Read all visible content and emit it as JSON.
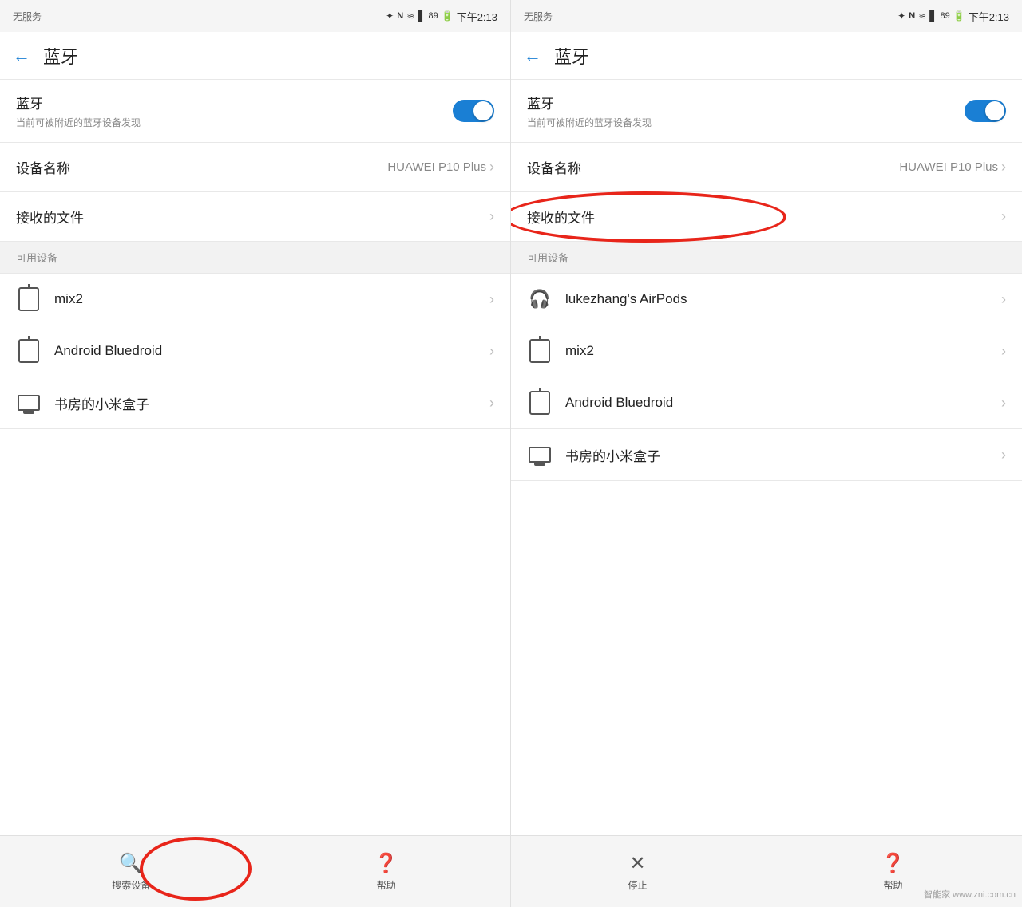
{
  "left_panel": {
    "status": {
      "left_text": "无服务",
      "right_icons": "✦ NFC ≋ □",
      "battery_pct": "89",
      "time": "下午2:13"
    },
    "header": {
      "back_label": "←",
      "title": "蓝牙"
    },
    "bluetooth": {
      "label": "蓝牙",
      "sublabel": "当前可被附近的蓝牙设备发现",
      "toggle_on": true
    },
    "device_name": {
      "label": "设备名称",
      "value": "HUAWEI P10 Plus"
    },
    "received_files": {
      "label": "接收的文件"
    },
    "available_section": "可用设备",
    "devices": [
      {
        "icon": "tablet",
        "name": "mix2"
      },
      {
        "icon": "tablet",
        "name": "Android Bluedroid"
      },
      {
        "icon": "tv",
        "name": "书房的小米盒子"
      }
    ],
    "bottom_bar": {
      "search_label": "搜索设备",
      "help_label": "帮助"
    }
  },
  "right_panel": {
    "status": {
      "left_text": "无服务",
      "right_icons": "✦ NFC ≋ □",
      "battery_pct": "89",
      "time": "下午2:13"
    },
    "header": {
      "back_label": "←",
      "title": "蓝牙"
    },
    "bluetooth": {
      "label": "蓝牙",
      "sublabel": "当前可被附近的蓝牙设备发现",
      "toggle_on": true
    },
    "device_name": {
      "label": "设备名称",
      "value": "HUAWEI P10 Plus"
    },
    "received_files": {
      "label": "接收的文件"
    },
    "available_section": "可用设备",
    "devices": [
      {
        "icon": "headphone",
        "name": "lukezhang's AirPods"
      },
      {
        "icon": "tablet",
        "name": "mix2"
      },
      {
        "icon": "tablet",
        "name": "Android Bluedroid"
      },
      {
        "icon": "tv",
        "name": "书房的小米盒子"
      }
    ],
    "bottom_bar": {
      "stop_label": "停止",
      "help_label": "帮助"
    }
  },
  "watermark": "智能家 www.zni.com.cn"
}
